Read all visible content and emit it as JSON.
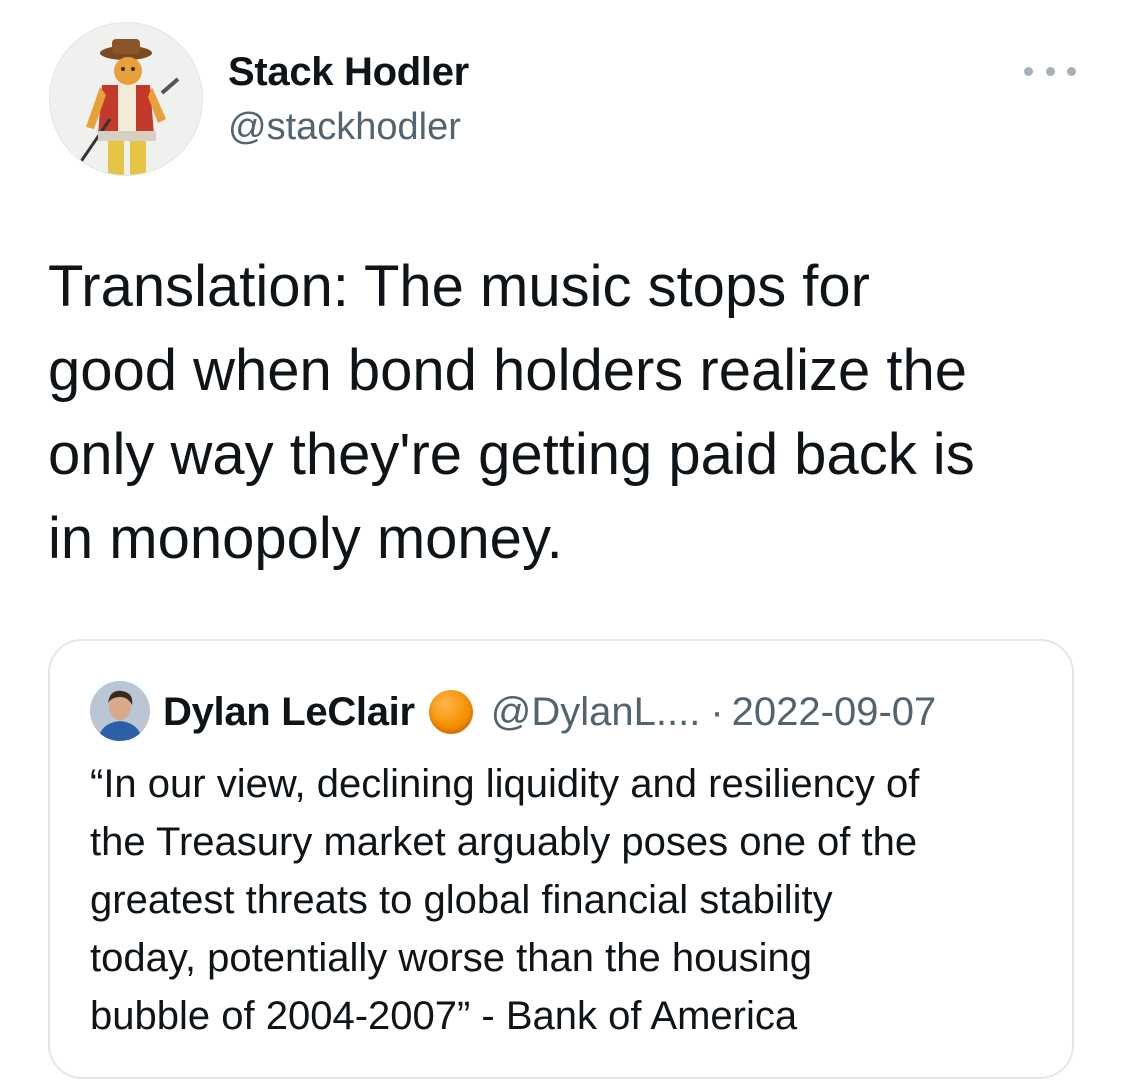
{
  "author": {
    "name": "Stack Hodler",
    "handle": "@stackhodler",
    "avatar_icon": "avatar-illustration-icon"
  },
  "more_icon": "more-options-icon",
  "tweet": {
    "text": "Translation: The music stops for\ngood when bond holders realize the\nonly way they're getting paid back is\nin monopoly money."
  },
  "quoted_tweet": {
    "author_name": "Dylan LeClair",
    "badge_icon": "orange-circle-icon",
    "badge_color": "#f69100",
    "handle": "@DylanL....",
    "separator": "·",
    "date": "2022-09-07",
    "text": "“In our view, declining liquidity and resiliency of\nthe Treasury market arguably poses one of the\ngreatest threats to global financial stability\ntoday, potentially worse than the housing\nbubble of 2004-2007” - Bank of America"
  },
  "colors": {
    "text_primary": "#0f1419",
    "text_secondary": "#536471",
    "border": "#e4e7e9"
  }
}
